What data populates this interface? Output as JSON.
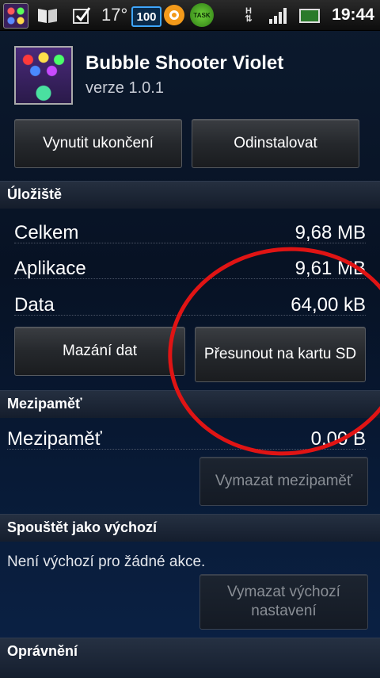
{
  "status_bar": {
    "temperature": "17°",
    "badge": "100",
    "task_label": "TASK",
    "network": "H",
    "time": "19:44"
  },
  "header": {
    "app_name": "Bubble Shooter Violet",
    "version": "verze 1.0.1"
  },
  "actions": {
    "force_stop": "Vynutit ukončení",
    "uninstall": "Odinstalovat"
  },
  "storage": {
    "title": "Úložiště",
    "rows": [
      {
        "label": "Celkem",
        "value": "9,68 MB"
      },
      {
        "label": "Aplikace",
        "value": "9,61 MB"
      },
      {
        "label": "Data",
        "value": "64,00 kB"
      }
    ],
    "clear_data": "Mazání dat",
    "move_to_sd": "Přesunout na kartu SD"
  },
  "cache": {
    "title": "Mezipaměť",
    "label": "Mezipaměť",
    "value": "0,00 B",
    "clear_cache": "Vymazat mezipaměť"
  },
  "defaults": {
    "title": "Spouštět jako výchozí",
    "text": "Není výchozí pro žádné akce.",
    "clear_defaults": "Vymazat výchozí nastavení"
  },
  "permissions": {
    "title": "Oprávnění"
  },
  "colors": {
    "annotation": "#e01414",
    "accent": "#3ea6ff"
  }
}
